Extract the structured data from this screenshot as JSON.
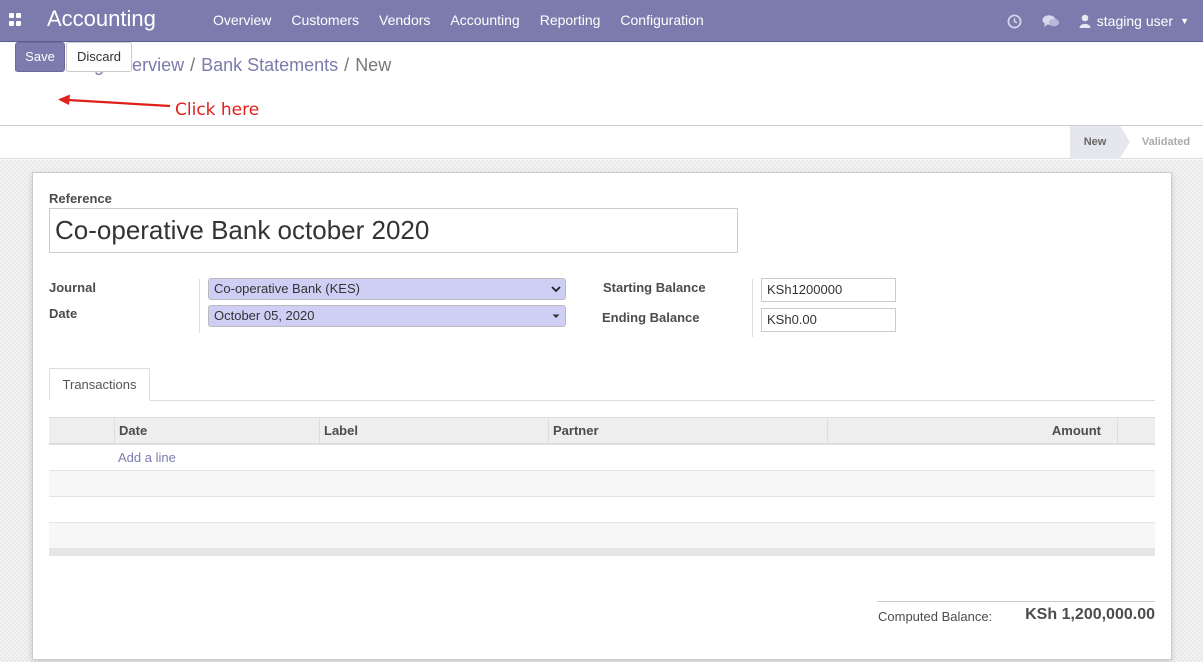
{
  "navbar": {
    "app_name": "Accounting",
    "menu": [
      "Overview",
      "Customers",
      "Vendors",
      "Accounting",
      "Reporting",
      "Configuration"
    ],
    "user": "staging user"
  },
  "breadcrumb": {
    "items": [
      "Accounting Overview",
      "Bank Statements"
    ],
    "current": "New",
    "separator": "/"
  },
  "buttons": {
    "save": "Save",
    "discard": "Discard"
  },
  "annotation": {
    "text": "Click here",
    "color": "#e0201b"
  },
  "status": {
    "stages": [
      "New",
      "Validated"
    ],
    "active": "New"
  },
  "form": {
    "reference_label": "Reference",
    "reference_value": "Co-operative Bank october 2020",
    "journal_label": "Journal",
    "journal_value": "Co-operative Bank (KES)",
    "date_label": "Date",
    "date_value": "October 05, 2020",
    "starting_balance_label": "Starting Balance",
    "starting_balance_value": "KSh1200000",
    "ending_balance_label": "Ending Balance",
    "ending_balance_value": "KSh0.00"
  },
  "tabs": [
    "Transactions"
  ],
  "table": {
    "columns": [
      "Date",
      "Label",
      "Partner",
      "Amount"
    ],
    "add_line": "Add a line"
  },
  "footer": {
    "computed_balance_label": "Computed Balance:",
    "computed_balance_value": "KSh 1,200,000.00"
  },
  "colors": {
    "brand": "#7c7bad",
    "select_bg": "#cfcff5"
  }
}
